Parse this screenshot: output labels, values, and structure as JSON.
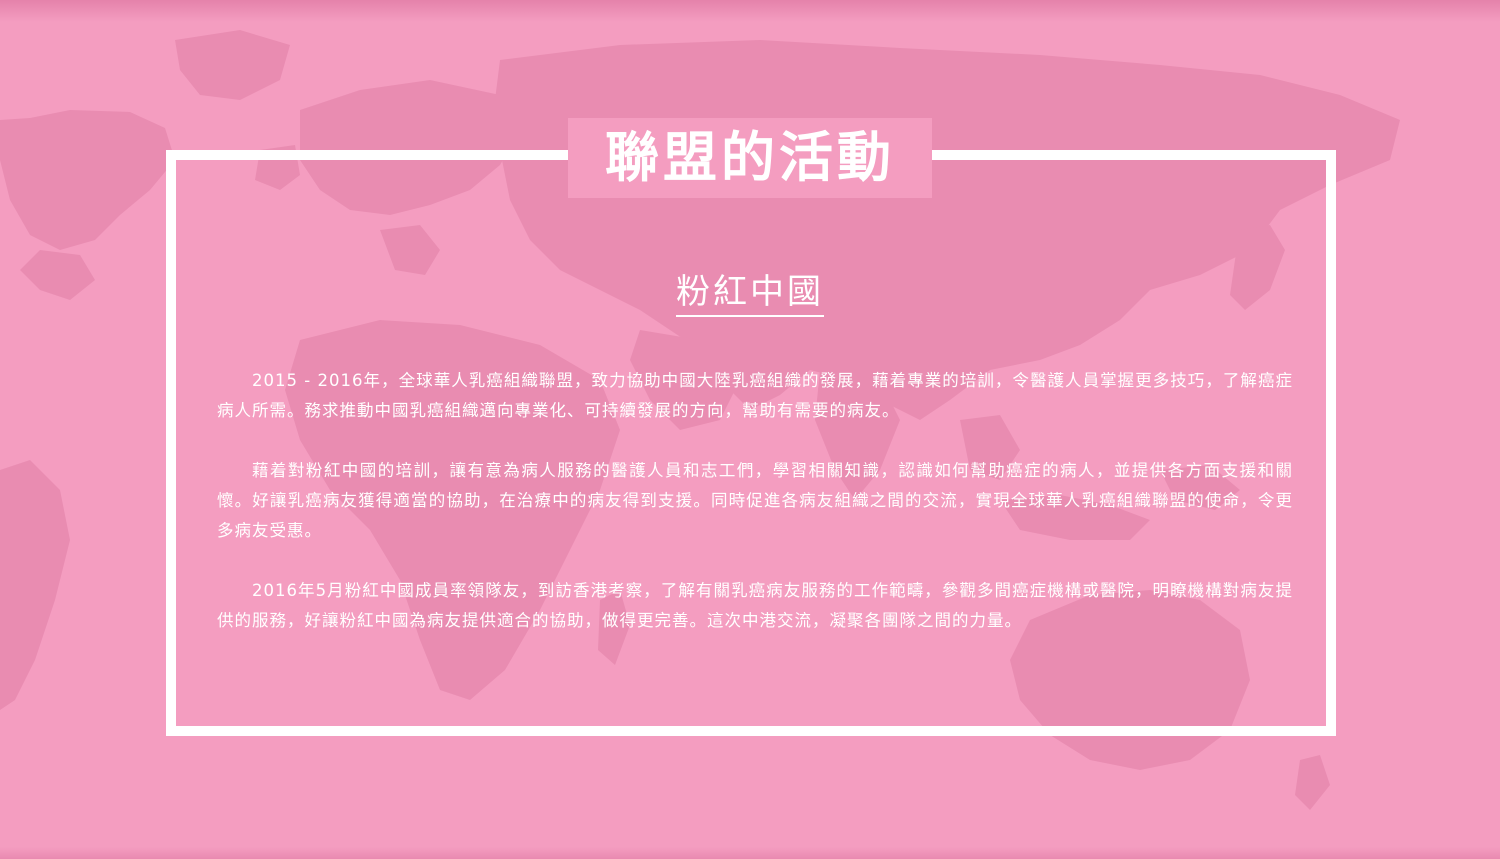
{
  "section_title": "聯盟的活動",
  "subtitle": "粉紅中國",
  "paragraphs": [
    "2015 - 2016年，全球華人乳癌組織聯盟，致力協助中國大陸乳癌組織的發展，藉着專業的培訓，令醫護人員掌握更多技巧，了解癌症病人所需。務求推動中國乳癌組織邁向專業化、可持續發展的方向，幫助有需要的病友。",
    "藉着對粉紅中國的培訓，讓有意為病人服務的醫護人員和志工們，學習相關知識，認識如何幫助癌症的病人，並提供各方面支援和關懷。好讓乳癌病友獲得適當的協助，在治療中的病友得到支援。同時促進各病友組織之間的交流，實現全球華人乳癌組織聯盟的使命，令更多病友受惠。",
    "2016年5月粉紅中國成員率領隊友，到訪香港考察，了解有關乳癌病友服務的工作範疇，參觀多間癌症機構或醫院，明瞭機構對病友提供的服務，好讓粉紅中國為病友提供適合的協助，做得更完善。這次中港交流，凝聚各團隊之間的力量。"
  ],
  "colors": {
    "background": "#f49dc0",
    "map": "#e98cb1",
    "frame": "#ffffff",
    "text": "#ffffff"
  },
  "background_graphic": "world-map"
}
